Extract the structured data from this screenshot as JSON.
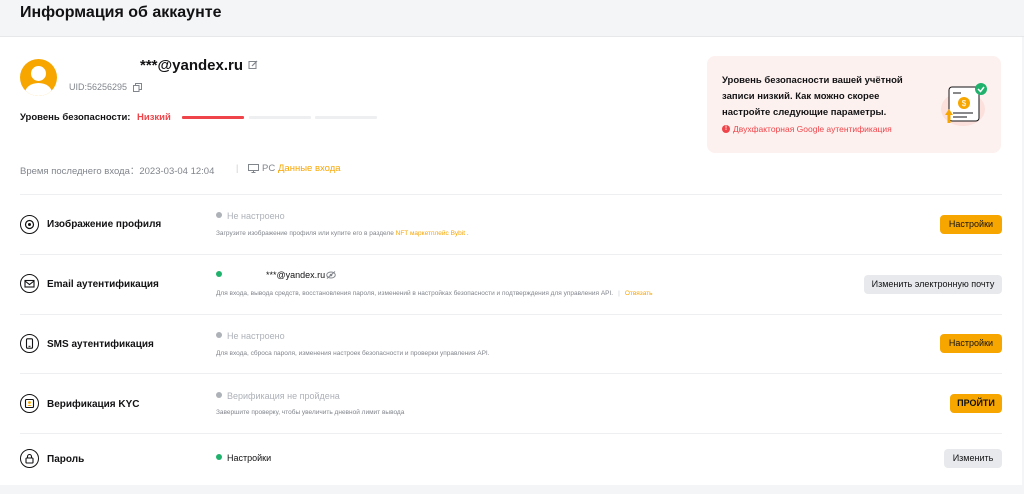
{
  "page": {
    "title": "Информация об аккаунте"
  },
  "account": {
    "email": "***@yandex.ru",
    "uid": "UID:56256295",
    "security_label": "Уровень безопасности:",
    "security_value": "Низкий",
    "security_level_filled": 1,
    "security_level_total": 3,
    "last_login_label": "Время последнего входа：2023-03-04 12:04",
    "login_device": "PC",
    "login_link": "Данные входа"
  },
  "alert": {
    "text": "Уровень безопасности вашей учётной записи низкий. Как можно скорее настройте следующие параметры.",
    "link": "Двухфакторная Google аутентификация"
  },
  "rows": [
    {
      "title": "Изображение профиля",
      "status": "Не настроено",
      "desc_before": "Загрузите изображение профиля или купите его в разделе",
      "desc_link": "NFT маркетплейс Bybit",
      "desc_after": ".",
      "button": "Настройки"
    },
    {
      "title": "Email аутентификация",
      "status_value": "***@yandex.ru",
      "desc": "Для входа, вывода средств, восстановления пароля, изменений в настройках безопасности и подтверждения для управления API.",
      "desc_link": "Отвязать",
      "button": "Изменить электронную почту"
    },
    {
      "title": "SMS аутентификация",
      "status": "Не настроено",
      "desc": "Для входа, сброса пароля, изменения настроек безопасности и проверки управления API.",
      "button": "Настройки"
    },
    {
      "title": "Верификация KYC",
      "status": "Верификация не пройдена",
      "desc": "Завершите проверку, чтобы увеличить дневной лимит вывода",
      "button": "ПРОЙТИ"
    },
    {
      "title": "Пароль",
      "status": "Настройки",
      "button": "Изменить"
    }
  ],
  "colors": {
    "accent": "#f7a600",
    "danger": "#ef454a",
    "success": "#20b26c"
  }
}
